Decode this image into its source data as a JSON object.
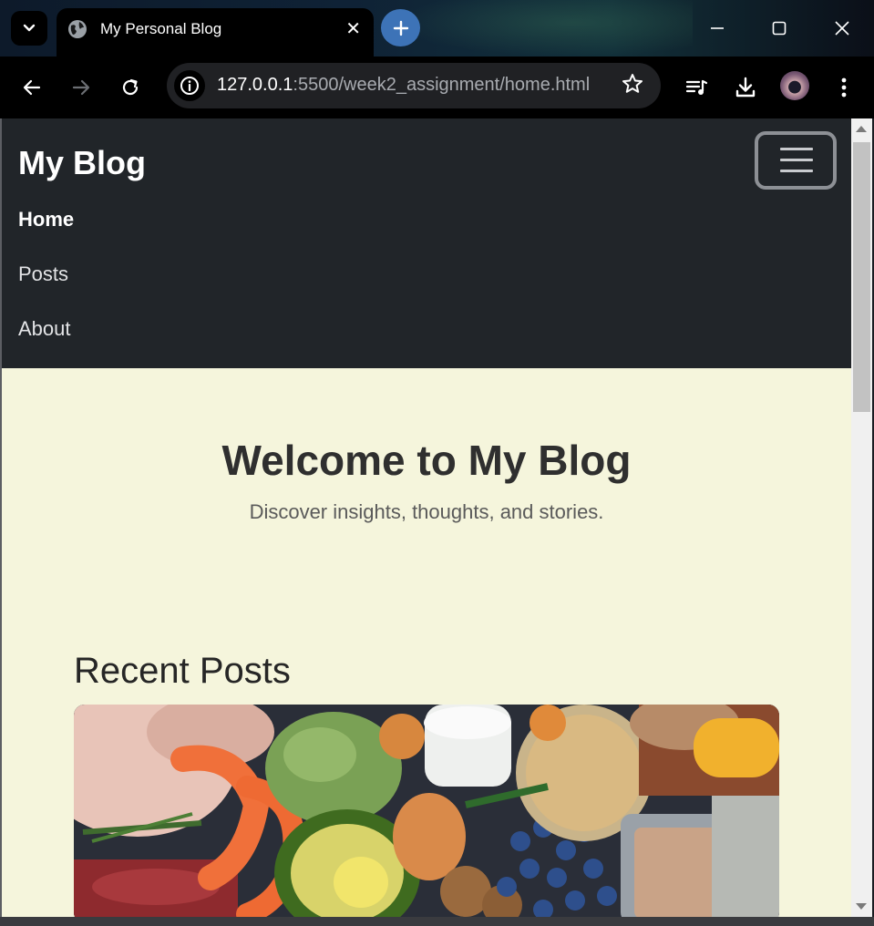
{
  "browser": {
    "tab": {
      "title": "My Personal Blog"
    },
    "address_bar": {
      "host": "127.0.0.1",
      "path": ":5500/week2_assignment/home.html"
    }
  },
  "navbar": {
    "brand": "My Blog",
    "links": [
      {
        "label": "Home",
        "active": true
      },
      {
        "label": "Posts",
        "active": false
      },
      {
        "label": "About",
        "active": false
      }
    ],
    "background": "#212529"
  },
  "hero": {
    "title": "Welcome to My Blog",
    "subtitle": "Discover insights, thoughts, and stories."
  },
  "recent_posts": {
    "heading": "Recent Posts",
    "first_post_image": "assorted-healthy-food-photo"
  },
  "colors": {
    "page_background": "#f5f5dc",
    "newtab_button": "#3d73b7"
  }
}
